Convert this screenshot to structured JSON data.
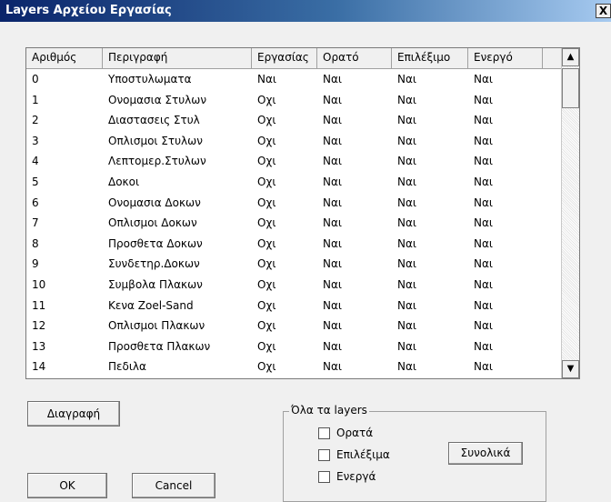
{
  "window": {
    "title": "Layers Αρχείου Εργασίας",
    "close_glyph": "X"
  },
  "table": {
    "columns": [
      "Αριθμός",
      "Περιγραφή",
      "Εργασίας",
      "Ορατό",
      "Επιλέξιμο",
      "Ενεργό"
    ],
    "rows": [
      [
        "0",
        "Υποστυλωματα",
        "Ναι",
        "Ναι",
        "Ναι",
        "Ναι"
      ],
      [
        "1",
        "Ονομασια Στυλων",
        "Οχι",
        "Ναι",
        "Ναι",
        "Ναι"
      ],
      [
        "2",
        "Διαστασεις Στυλ",
        "Οχι",
        "Ναι",
        "Ναι",
        "Ναι"
      ],
      [
        "3",
        "Οπλισμοι Στυλων",
        "Οχι",
        "Ναι",
        "Ναι",
        "Ναι"
      ],
      [
        "4",
        "Λεπτομερ.Στυλων",
        "Οχι",
        "Ναι",
        "Ναι",
        "Ναι"
      ],
      [
        "5",
        "Δοκοι",
        "Οχι",
        "Ναι",
        "Ναι",
        "Ναι"
      ],
      [
        "6",
        "Ονομασια Δοκων",
        "Οχι",
        "Ναι",
        "Ναι",
        "Ναι"
      ],
      [
        "7",
        "Οπλισμοι Δοκων",
        "Οχι",
        "Ναι",
        "Ναι",
        "Ναι"
      ],
      [
        "8",
        "Προσθετα Δοκων",
        "Οχι",
        "Ναι",
        "Ναι",
        "Ναι"
      ],
      [
        "9",
        "Συνδετηρ.Δοκων",
        "Οχι",
        "Ναι",
        "Ναι",
        "Ναι"
      ],
      [
        "10",
        "Συμβολα Πλακων",
        "Οχι",
        "Ναι",
        "Ναι",
        "Ναι"
      ],
      [
        "11",
        "Κενα Zoel-Sand",
        "Οχι",
        "Ναι",
        "Ναι",
        "Ναι"
      ],
      [
        "12",
        "Οπλισμοι Πλακων",
        "Οχι",
        "Ναι",
        "Ναι",
        "Ναι"
      ],
      [
        "13",
        "Προσθετα Πλακων",
        "Οχι",
        "Ναι",
        "Ναι",
        "Ναι"
      ],
      [
        "14",
        "Πεδιλα",
        "Οχι",
        "Ναι",
        "Ναι",
        "Ναι"
      ]
    ],
    "scroll_up_glyph": "▲",
    "scroll_down_glyph": "▼"
  },
  "buttons": {
    "delete": "Διαγραφή",
    "ok": "OK",
    "cancel": "Cancel",
    "totals": "Συνολικά"
  },
  "all_layers": {
    "legend": "Όλα τα layers",
    "visible": {
      "label": "Ορατά",
      "checked": false
    },
    "selectable": {
      "label": "Επιλέξιμα",
      "checked": false
    },
    "active": {
      "label": "Ενεργά",
      "checked": false
    }
  }
}
